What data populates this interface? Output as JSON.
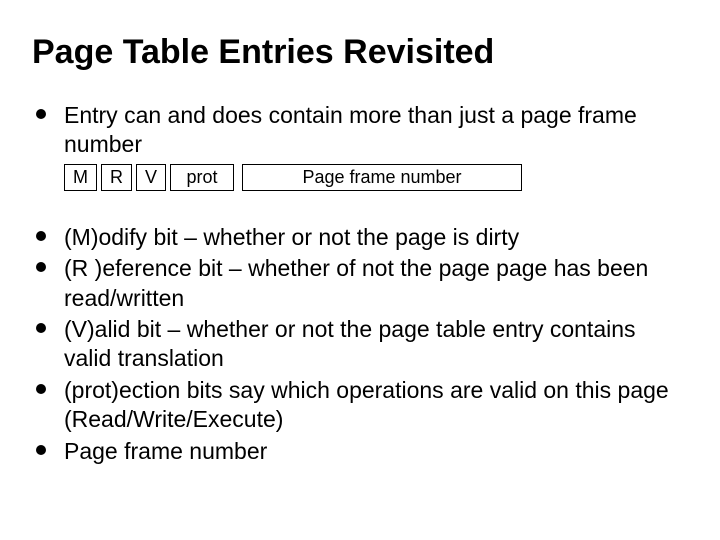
{
  "title": "Page Table Entries Revisited",
  "intro": "Entry can and does contain more than just a page frame number",
  "pte": {
    "m": "M",
    "r": "R",
    "v": "V",
    "prot": "prot",
    "pfn": "Page frame number"
  },
  "bullets": {
    "b1": "(M)odify bit – whether or not the page is dirty",
    "b2": "(R )eference bit – whether of not the page page has been read/written",
    "b3": "(V)alid bit – whether or not the page table entry contains valid translation",
    "b4": "(prot)ection bits say which operations are valid on this page (Read/Write/Execute)",
    "b5": "Page frame number"
  }
}
